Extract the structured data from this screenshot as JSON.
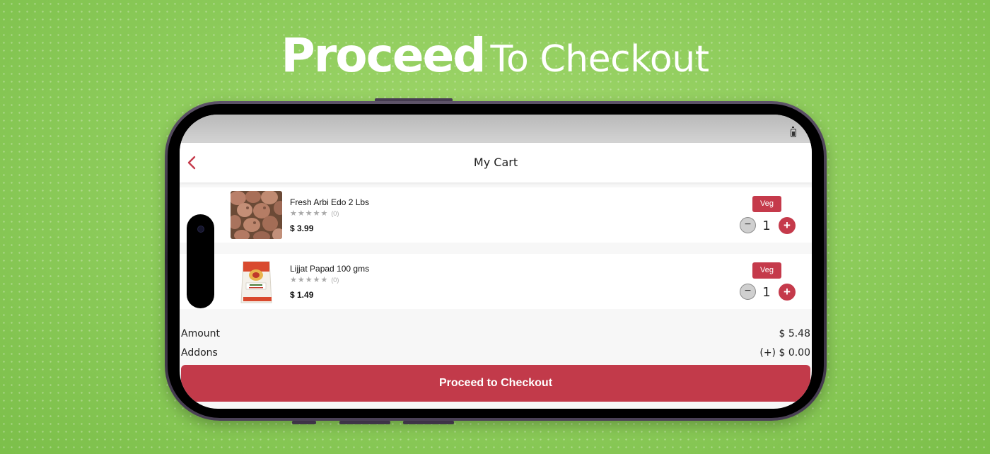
{
  "banner": {
    "title_bold": "Proceed",
    "title_light": "To Checkout"
  },
  "header": {
    "title": "My Cart",
    "back_icon": "chevron-left-icon"
  },
  "cart": {
    "items": [
      {
        "name": "Fresh Arbi Edo 2 Lbs",
        "stars": "★★★★★",
        "rating_count": "(0)",
        "price": "$ 3.99",
        "badge": "Veg",
        "quantity": "1",
        "minus": "−",
        "plus": "+"
      },
      {
        "name": "Lijjat Papad 100 gms",
        "stars": "★★★★★",
        "rating_count": "(0)",
        "price": "$ 1.49",
        "badge": "Veg",
        "quantity": "1",
        "minus": "−",
        "plus": "+"
      }
    ]
  },
  "summary": {
    "amount_label": "Amount",
    "amount_value": "$ 5.48",
    "addons_label": "Addons",
    "addons_value": "(+) $ 0.00"
  },
  "checkout": {
    "button_label": "Proceed to Checkout"
  },
  "colors": {
    "accent": "#c53a4b",
    "background": "#8fcb5c"
  }
}
